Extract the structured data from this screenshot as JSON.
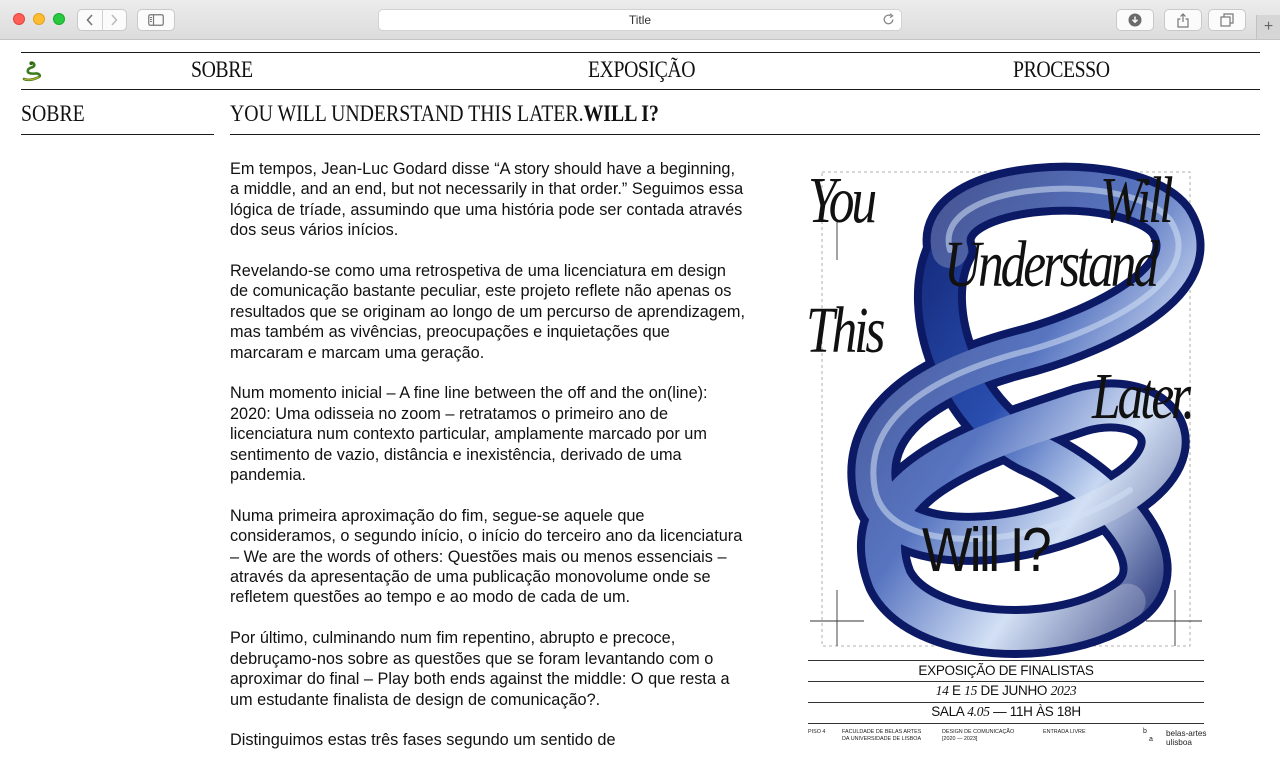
{
  "browser": {
    "title": "Title"
  },
  "nav": {
    "items": [
      "SOBRE",
      "EXPOSIÇÃO",
      "PROCESSO"
    ]
  },
  "section": {
    "label": "SOBRE",
    "title_main": "YOU WILL UNDERSTAND THIS LATER.",
    "title_bold": "WILL I?"
  },
  "body": {
    "paragraphs": [
      "Em tempos, Jean-Luc Godard disse “A story should have a beginning, a middle, and an end, but not necessarily in that order.” Seguimos essa lógica de tríade, assumindo que uma história pode ser contada através dos seus vários inícios.",
      "Revelando-se como uma retrospetiva de uma licenciatura em design de comunicação bastante peculiar, este projeto reflete não apenas os resultados que se originam ao longo de um percurso de aprendizagem, mas também as vivências, preocupações e inquietações que marcaram e marcam uma geração.",
      "Num momento inicial – A fine line between the off and the on(line): 2020: Uma odisseia no zoom – retratamos o primeiro ano de licenciatura num contexto particular, amplamente marcado por um sentimento de vazio, distância e inexistência, derivado de uma pandemia.",
      "Numa primeira aproximação do fim, segue-se aquele que consideramos, o segundo início, o início do terceiro ano da licenciatura – We are the words of others: Questões mais ou menos essenciais – através da apresentação de uma publicação monovolume onde se refletem questões ao tempo e ao modo de cada de um.",
      "Por último, culminando num fim repentino, abrupto e precoce, debruçamo-nos sobre as questões que se foram levantando com o aproximar do final – Play both ends against the middle: O que resta a um estudante finalista de design de comunicação?.",
      "Distinguimos estas três fases segundo um sentido de"
    ]
  },
  "poster": {
    "words": {
      "you": "You",
      "will": "Will",
      "understand": "Understand",
      "this": "This",
      "later": "Later.",
      "will_i": "Will I?"
    },
    "info": {
      "line1": "EXPOSIÇÃO DE FINALISTAS",
      "dates_start": "14",
      "dates_e": " E ",
      "dates_end": "15",
      "dates_rest": " DE JUNHO ",
      "year": "2023",
      "sala_label": "SALA ",
      "sala_num": "4.05",
      "hours": " — 11H ÀS 18H"
    },
    "footer": {
      "floor": "PISO 4",
      "faculty_1": "FACULDADE DE BELAS ARTES",
      "faculty_2": "DA UNIVERSIDADE DE LISBOA",
      "course_1": "DESIGN DE COMUNICAÇÃO",
      "course_2": "[2020 — 2023]",
      "entry": "ENTRADA LIVRE",
      "logo_mark_1": "b",
      "logo_mark_2": "a",
      "logo_1": "belas-artes",
      "logo_2": "ulisboa"
    },
    "colors": {
      "deep_blue": "#0c1a66",
      "mid_blue": "#2a4fb0",
      "light_blue": "#c7d8f2"
    }
  }
}
